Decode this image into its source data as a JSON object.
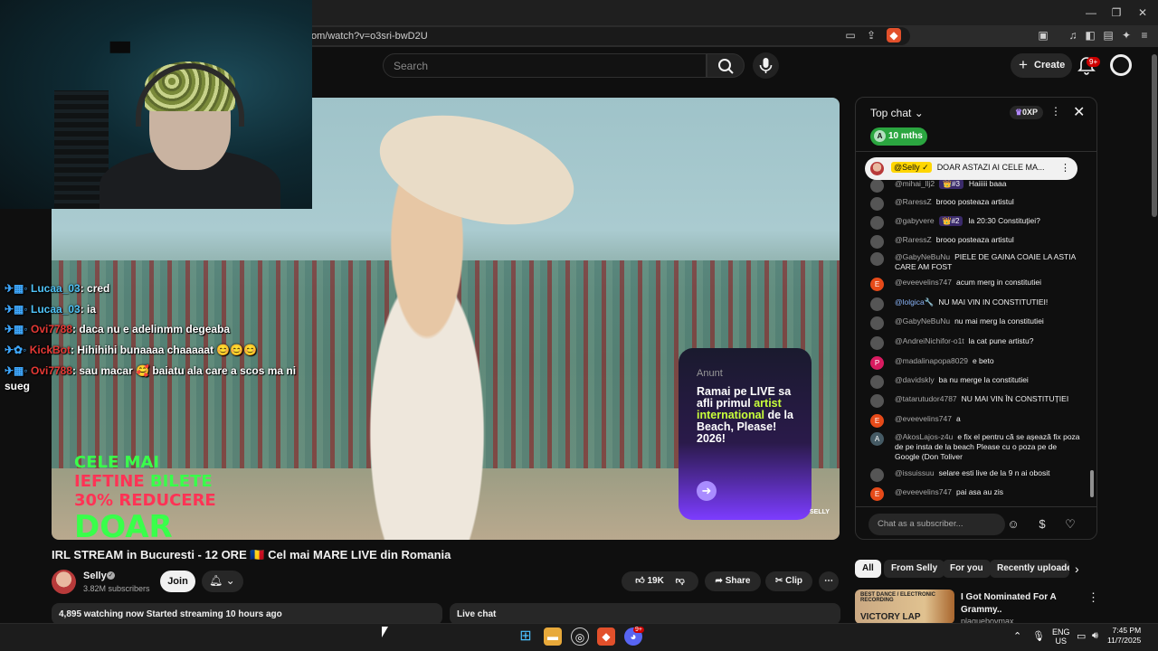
{
  "browser": {
    "url": "om/watch?v=o3sri-bwD2U",
    "window_controls": [
      "—",
      "❐",
      "✕"
    ]
  },
  "header": {
    "search_placeholder": "Search",
    "create_label": "Create",
    "notifications_badge": "9+"
  },
  "stream_overlay": {
    "chat_lines": [
      {
        "user": "Lucaa_03",
        "text": ": cred"
      },
      {
        "user": "Lucaa_03",
        "text": ": ia"
      },
      {
        "user": "Ovi7788",
        "text": ": daca nu e adelinmm degeaba"
      },
      {
        "user": "KickBot",
        "text": ": Hihihihi bunaaaa chaaaaat 😊😊😊"
      },
      {
        "user": "Ovi7788",
        "text": ": sau macar 🥰 baiatu ala care a scos ma ni"
      },
      {
        "user": "",
        "text": "sueg"
      }
    ]
  },
  "video": {
    "promo_line1_a": "CELE MAI ",
    "promo_line1_b": "IEFTINE",
    "promo_line1_c": " BILETE",
    "promo_line2": "30% REDUCERE",
    "promo_line3": "DOAR AZI",
    "ad_head": "Anunt",
    "ad_body_1": "Ramai pe LIVE sa afli primul",
    "ad_body_hl": "artist international",
    "ad_body_2": "de la Beach, Please! 2026!",
    "ad_brand": "SELLY",
    "title": "IRL STREAM in Bucuresti - 12 ORE 🇷🇴 Cel mai MARE LIVE din Romania"
  },
  "channel": {
    "name": "Selly",
    "subscribers": "3.82M subscribers",
    "join_label": "Join"
  },
  "actions": {
    "likes": "19K",
    "share": "Share",
    "clip": "Clip"
  },
  "description_bar": {
    "stats": "4,895 watching now  Started streaming 10 hours ago"
  },
  "livechat_bar": {
    "label": "Live chat"
  },
  "chat": {
    "mode": "Top chat",
    "xp": "0XP",
    "member_label": "10 mths",
    "member_initial": "A",
    "pinned_author": "@Selly ✓",
    "pinned_text": "DOAR ASTAZI AI CELE MA...",
    "input_placeholder": "Chat as a subscriber...",
    "messages": [
      {
        "author": "@mihai_llj2",
        "rank": "👑#3",
        "text": "Haiiiii baaa",
        "initial": ""
      },
      {
        "author": "@RaressZ",
        "rank": "",
        "text": "brooo posteaza artistul",
        "initial": ""
      },
      {
        "author": "@gabyvere",
        "rank": "👑#2",
        "text": "la 20:30 Constituției?",
        "initial": ""
      },
      {
        "author": "@RaressZ",
        "rank": "",
        "text": "brooo posteaza artistul",
        "initial": ""
      },
      {
        "author": "@GabyNeBuNu",
        "rank": "",
        "text": "PIELE DE GAINA COAIE LA ASTIA CARE AM FOST",
        "initial": ""
      },
      {
        "author": "@eveevelins747",
        "rank": "",
        "text": "acum merg in constitutiei",
        "initial": "E"
      },
      {
        "author": "@lolgica🔧",
        "rank": "",
        "text": "NU MAI VIN IN CONSTITUTIEI!",
        "initial": ""
      },
      {
        "author": "@GabyNeBuNu",
        "rank": "",
        "text": "nu mai merg la constitutiei",
        "initial": ""
      },
      {
        "author": "@AndreiNichifor-o1t",
        "rank": "",
        "text": "la cat pune artistu?",
        "initial": ""
      },
      {
        "author": "@madalinapopa8029",
        "rank": "",
        "text": "e beto",
        "initial": "P"
      },
      {
        "author": "@davidskly",
        "rank": "",
        "text": "ba nu merge la constitutiei",
        "initial": ""
      },
      {
        "author": "@tatarutudor4787",
        "rank": "",
        "text": "NU MAI VIN ÎN CONSTITUȚIEI",
        "initial": ""
      },
      {
        "author": "@eveevelins747",
        "rank": "",
        "text": "a",
        "initial": "E"
      },
      {
        "author": "@AkosLajos-z4u",
        "rank": "",
        "text": "e fix el pentru că se așează fix poza de pe insta de la beach Please cu o poza pe de Google (Don Toliver",
        "initial": "A"
      },
      {
        "author": "@issuissuu",
        "rank": "",
        "text": "selare esti live de la 9 n ai obosit",
        "initial": ""
      },
      {
        "author": "@eveevelins747",
        "rank": "",
        "text": "pai asa au zis",
        "initial": "E"
      }
    ]
  },
  "recommendations": {
    "chips": [
      "All",
      "From Selly",
      "For you",
      "Recently uploaded"
    ],
    "video_title": "I Got Nominated For A Grammy..",
    "channel": "plaquebovmax",
    "thumb_text": "BEST DANCE / ELECTRONIC RECORDING",
    "thumb_victory": "VICTORY LAP"
  },
  "taskbar": {
    "lang": "ENG",
    "region": "US",
    "time": "7:45 PM",
    "date": "11/7/2025",
    "discord_badge": "9+"
  },
  "colors": {
    "member_green": "#2ba640",
    "badge_red": "#cc0000",
    "promo_green": "#39ff4a"
  }
}
